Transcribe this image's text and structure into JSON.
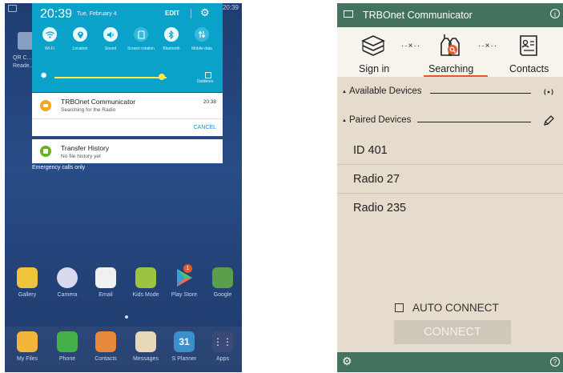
{
  "left_phone": {
    "status_time": "20:39",
    "background_app_label": "QR C... Reade...",
    "quick_settings": {
      "time": "20:39",
      "date": "Tue, February 4",
      "edit_label": "EDIT",
      "tiles": [
        {
          "label": "Wi-Fi",
          "icon": "wifi-icon"
        },
        {
          "label": "Location",
          "icon": "location-icon"
        },
        {
          "label": "Sound",
          "icon": "sound-icon"
        },
        {
          "label": "Screen rotation",
          "icon": "rotation-icon"
        },
        {
          "label": "Bluetooth",
          "icon": "bluetooth-icon"
        },
        {
          "label": "Mobile data",
          "icon": "mobile-data-icon"
        }
      ],
      "brightness_level": 0.86,
      "outdoors_label": "Outdoors"
    },
    "notifications": [
      {
        "title": "TRBOnet Communicator",
        "subtitle": "Searching for the Radio",
        "time": "20:38",
        "action": "CANCEL",
        "icon_color": "#f5a623"
      },
      {
        "title": "Transfer History",
        "subtitle": "No file history yet",
        "icon_color": "#6ab023"
      }
    ],
    "emergency_text": "Emergency calls only",
    "apps_row": [
      {
        "label": "Gallery",
        "color": "#f0c33c"
      },
      {
        "label": "Camera",
        "color": "#d9d9ef"
      },
      {
        "label": "Email",
        "color": "#f0f0f0"
      },
      {
        "label": "Kids Mode",
        "color": "#9cc440"
      },
      {
        "label": "Play Store",
        "color": "#34a0d8",
        "badge": "1"
      },
      {
        "label": "Google",
        "color": "#5aa04a"
      }
    ],
    "dock": [
      {
        "label": "My Files",
        "color": "#f3b63a"
      },
      {
        "label": "Phone",
        "color": "#43b049"
      },
      {
        "label": "Contacts",
        "color": "#e7893a"
      },
      {
        "label": "Messages",
        "color": "#e7d8b8"
      },
      {
        "label": "S Planner",
        "color": "#3b8fcb",
        "glyph": "31"
      },
      {
        "label": "Apps",
        "color": "#3a4a78",
        "glyph": "⋮⋮"
      }
    ]
  },
  "right_phone": {
    "app_title": "TRBOnet Communicator",
    "tabs": [
      {
        "label": "Sign in",
        "icon": "sign-in-icon"
      },
      {
        "label": "Searching",
        "icon": "searching-radio-icon",
        "active": true
      },
      {
        "label": "Contacts",
        "icon": "contacts-card-icon"
      }
    ],
    "link_dots": "··×··",
    "sections": {
      "available": "Available Devices",
      "paired": "Paired Devices"
    },
    "paired_devices": [
      "ID 401",
      "Radio 27",
      "Radio 235"
    ],
    "auto_connect_label": "AUTO CONNECT",
    "connect_label": "CONNECT",
    "accent_color": "#43735f",
    "tab_indicator_color": "#e8562a"
  }
}
